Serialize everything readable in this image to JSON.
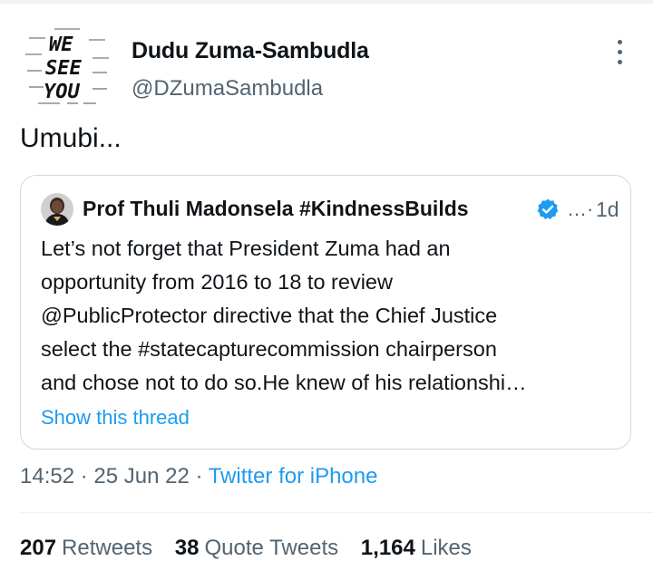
{
  "author": {
    "avatar_lines": [
      "WE",
      "SEE",
      "YOU"
    ],
    "display_name": "Dudu Zuma-Sambudla",
    "handle": "@DZumaSambudla"
  },
  "tweet": {
    "text": "Umubi..."
  },
  "quoted_tweet": {
    "display_name": "Prof Thuli Madonsela #KindnessBuilds",
    "verified_icon": "verified-badge-icon",
    "separator": "…·",
    "time": "1d",
    "body_lines": [
      "Let’s not forget that President Zuma had an",
      "opportunity from 2016 to 18 to review",
      "@PublicProtector directive that the Chief Justice",
      "select the #statecapturecommission chairperson",
      "and chose not to do so.He knew of his relationshi…"
    ],
    "show_thread": "Show this thread"
  },
  "meta": {
    "time": "14:52",
    "dot1": " · ",
    "date": "25 Jun 22",
    "dot2": " · ",
    "source": "Twitter for iPhone"
  },
  "stats": {
    "retweets_count": "207",
    "retweets_label": "Retweets",
    "quotes_count": "38",
    "quotes_label": "Quote Tweets",
    "likes_count": "1,164",
    "likes_label": "Likes"
  },
  "colors": {
    "accent": "#1d9bf0",
    "text_primary": "#0f1419",
    "text_secondary": "#536471",
    "border": "#cfd9de"
  }
}
